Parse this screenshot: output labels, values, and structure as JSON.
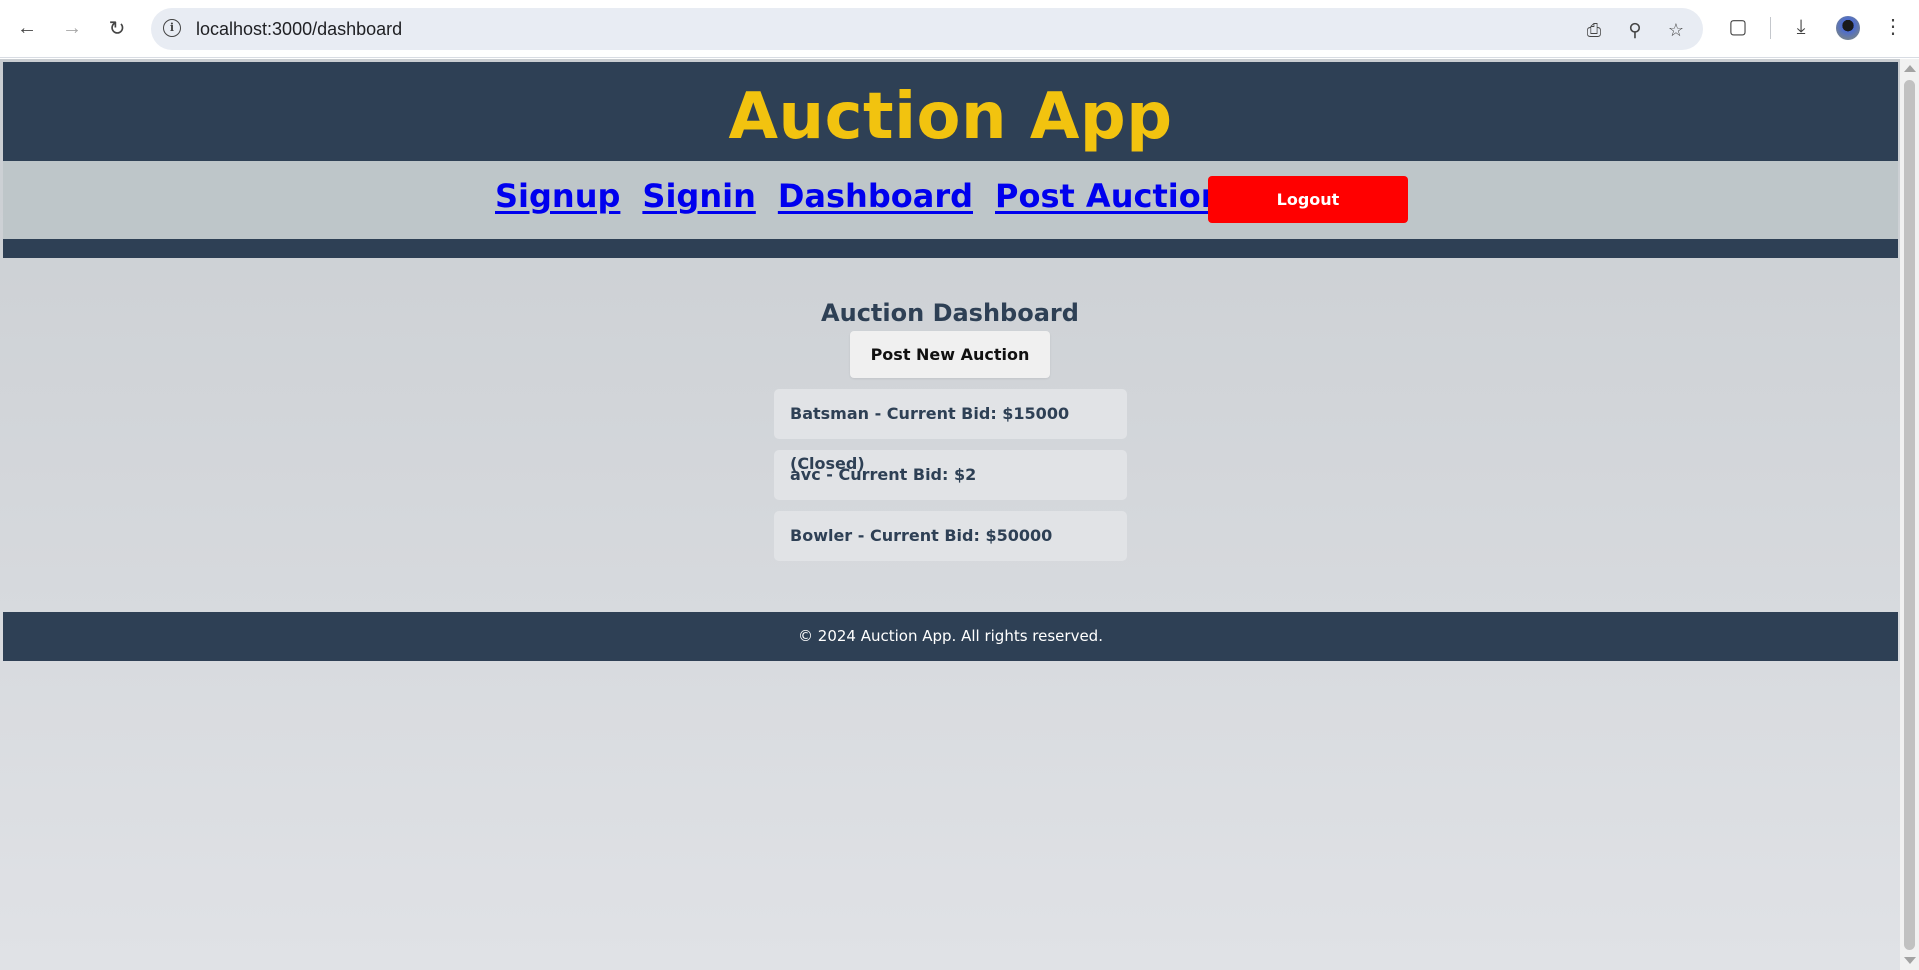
{
  "browser": {
    "url": "localhost:3000/dashboard",
    "icons": [
      "back-arrow-icon",
      "forward-arrow-icon",
      "reload-icon",
      "info-icon",
      "install-app-icon",
      "zoom-icon",
      "bookmark-star-icon",
      "extensions-icon",
      "download-icon",
      "profile-avatar",
      "menu-dots-icon"
    ]
  },
  "header": {
    "title": "Auction App"
  },
  "nav": {
    "links": [
      "Signup",
      "Signin",
      "Dashboard",
      "Post Auction"
    ],
    "logout_label": "Logout"
  },
  "main": {
    "title": "Auction Dashboard",
    "post_button_label": "Post New Auction",
    "auctions": [
      "Batsman - Current Bid: $15000 (Closed)",
      "avc - Current Bid: $2",
      "Bowler - Current Bid: $50000"
    ]
  },
  "footer": {
    "text": "© 2024 Auction App. All rights reserved."
  },
  "colors": {
    "header_bg": "#2e4055",
    "title_yellow": "#f2c30f",
    "nav_bg": "#bec6c9",
    "link_blue": "#0000ee",
    "logout_red": "#ff0000"
  }
}
